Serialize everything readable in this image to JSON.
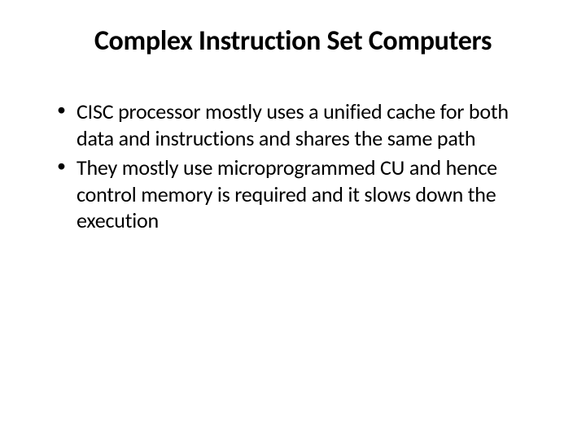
{
  "slide": {
    "title": "Complex Instruction Set Computers",
    "bullets": [
      "CISC processor mostly uses a unified cache for both data and instructions and shares the same path",
      "They mostly use microprogrammed CU and hence control memory is required and it slows down the execution"
    ]
  }
}
